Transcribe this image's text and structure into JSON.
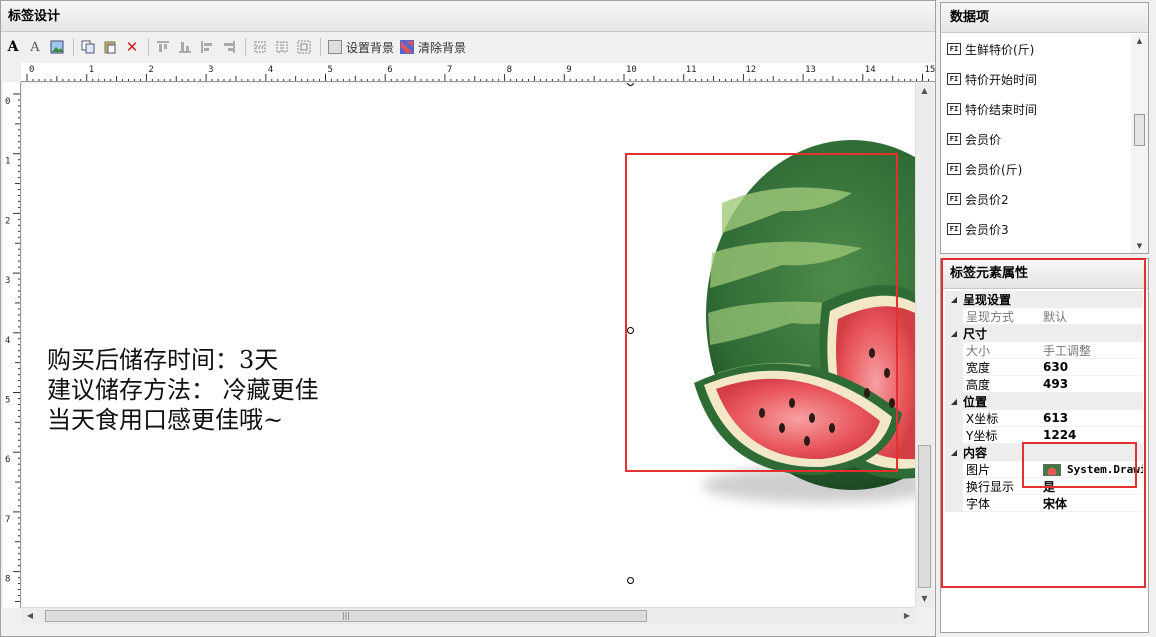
{
  "designer": {
    "title": "标签设计",
    "toolbar": {
      "set_background": "设置背景",
      "clear_background": "清除背景"
    },
    "ruler_top": [
      "0",
      "1",
      "2",
      "3",
      "4",
      "5",
      "6",
      "7",
      "8",
      "9",
      "10",
      "11",
      "12",
      "13",
      "14",
      "15"
    ],
    "ruler_left": [
      "0",
      "1",
      "2",
      "3",
      "4",
      "5",
      "6",
      "7",
      "8"
    ],
    "label_text": "购买后储存时间：3天\n建议储存方法： 冷藏更佳\n当天食用口感更佳哦~"
  },
  "data_panel": {
    "title": "数据项",
    "items": [
      {
        "label": "生鲜特价(斤)"
      },
      {
        "label": "特价开始时间"
      },
      {
        "label": "特价结束时间"
      },
      {
        "label": "会员价"
      },
      {
        "label": "会员价(斤)"
      },
      {
        "label": "会员价2"
      },
      {
        "label": "会员价3"
      }
    ],
    "item_icon_text": "FI"
  },
  "props_panel": {
    "title": "标签元素属性",
    "cat_display": "呈现设置",
    "display_mode_label": "呈现方式",
    "display_mode_value": "默认",
    "cat_size": "尺寸",
    "size_label": "大小",
    "size_value": "手工调整",
    "width_label": "宽度",
    "width_value": "630",
    "height_label": "高度",
    "height_value": "493",
    "cat_position": "位置",
    "x_label": "X坐标",
    "x_value": "613",
    "y_label": "Y坐标",
    "y_value": "1224",
    "cat_content": "内容",
    "image_label": "图片",
    "image_value": "System.Drawing.Bitmap",
    "wrap_label": "换行显示",
    "wrap_value": "是",
    "font_label": "字体",
    "font_value": "宋体"
  },
  "colors": {
    "highlight_red": "#e53030",
    "watermelon_green": "#2f6b35",
    "watermelon_red": "#e8555a"
  }
}
